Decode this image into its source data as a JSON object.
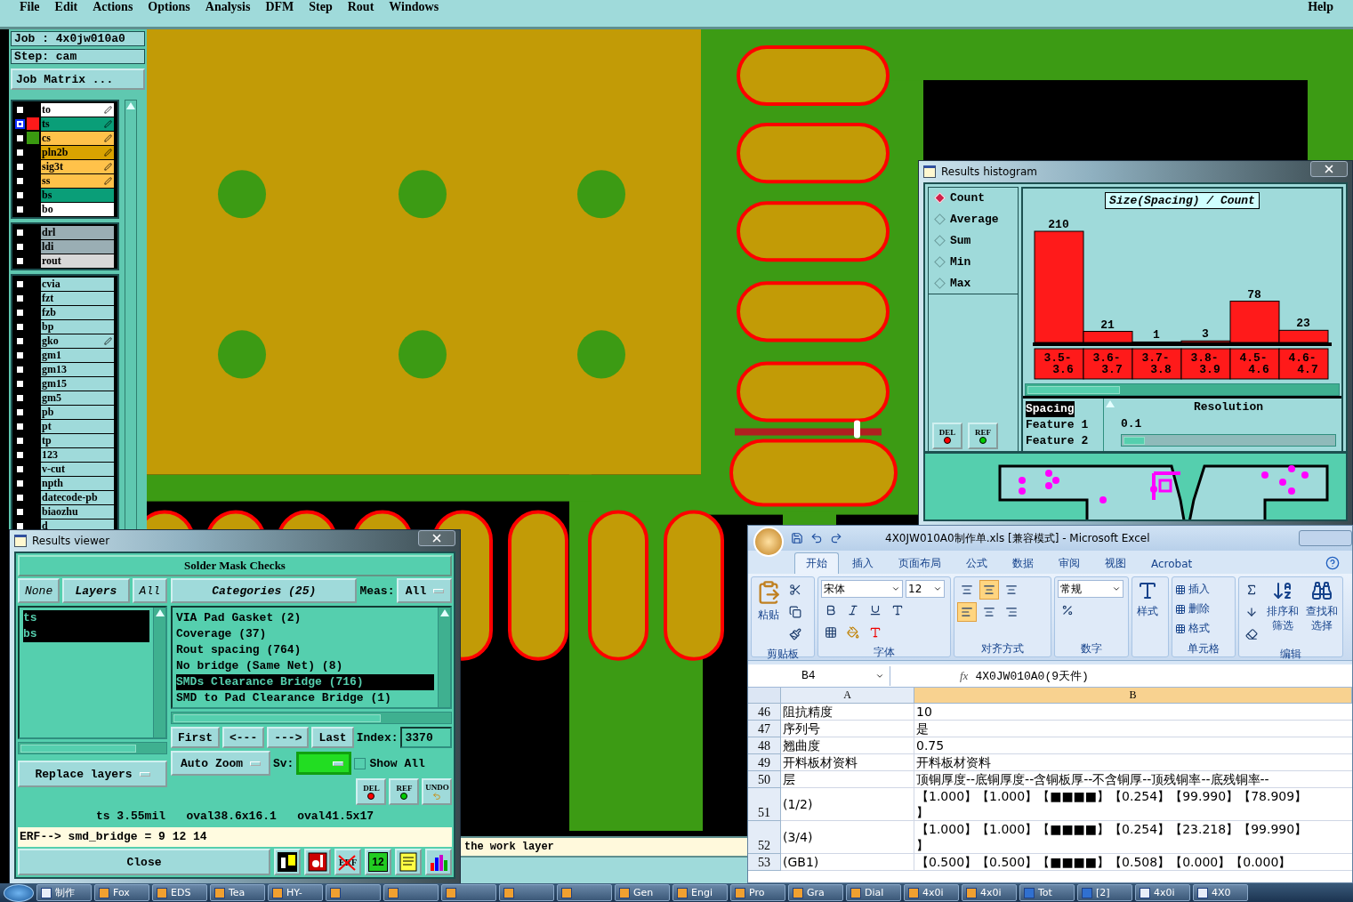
{
  "menu_bar": {
    "items": [
      "File",
      "Edit",
      "Actions",
      "Options",
      "Analysis",
      "DFM",
      "Step",
      "Rout",
      "Windows"
    ],
    "help": "Help"
  },
  "job_panel": {
    "job": "Job : 4x0jw010a0",
    "step": "Step: cam",
    "matrix_button": "Job Matrix ..."
  },
  "layer_groups": [
    {
      "items": [
        {
          "name": "to",
          "color": "#ffffff",
          "editable": true,
          "selected": false
        },
        {
          "name": "ts",
          "color": "#0a9e78",
          "swatch": {
            "color": "#ff1a1a"
          },
          "editable": true,
          "selected": true
        },
        {
          "name": "cs",
          "color": "#ffc24a",
          "swatch": {
            "color": "#3a9a10"
          },
          "editable": true,
          "selected": false
        },
        {
          "name": "pln2b",
          "color": "#d9a300",
          "editable": true,
          "selected": false
        },
        {
          "name": "sig3t",
          "color": "#ffc24a",
          "editable": true,
          "selected": false
        },
        {
          "name": "ss",
          "color": "#ffc24a",
          "editable": true,
          "selected": false
        },
        {
          "name": "bs",
          "color": "#0a9e78",
          "editable": false,
          "selected": false
        },
        {
          "name": "bo",
          "color": "#ffffff",
          "editable": false,
          "selected": false
        }
      ]
    },
    {
      "items": [
        {
          "name": "drl",
          "color": "#9aaeb4",
          "editable": false,
          "selected": false
        },
        {
          "name": "ldi",
          "color": "#9aaeb4",
          "editable": false,
          "selected": false
        },
        {
          "name": "rout",
          "color": "#d8d8d8",
          "editable": false,
          "selected": false
        }
      ]
    },
    {
      "items": [
        {
          "name": "cvia",
          "color": "#9fdada",
          "editable": false,
          "selected": false
        },
        {
          "name": "fzt",
          "color": "#9fdada",
          "editable": false,
          "selected": false
        },
        {
          "name": "fzb",
          "color": "#9fdada",
          "editable": false,
          "selected": false
        },
        {
          "name": "bp",
          "color": "#9fdada",
          "editable": false,
          "selected": false
        },
        {
          "name": "gko",
          "color": "#9fdada",
          "editable": true,
          "selected": false
        },
        {
          "name": "gm1",
          "color": "#9fdada",
          "editable": false,
          "selected": false
        },
        {
          "name": "gm13",
          "color": "#9fdada",
          "editable": false,
          "selected": false
        },
        {
          "name": "gm15",
          "color": "#9fdada",
          "editable": false,
          "selected": false
        },
        {
          "name": "gm5",
          "color": "#9fdada",
          "editable": false,
          "selected": false
        },
        {
          "name": "pb",
          "color": "#9fdada",
          "editable": false,
          "selected": false
        },
        {
          "name": "pt",
          "color": "#9fdada",
          "editable": false,
          "selected": false
        },
        {
          "name": "tp",
          "color": "#9fdada",
          "editable": false,
          "selected": false
        },
        {
          "name": "123",
          "color": "#9fdada",
          "editable": false,
          "selected": false
        },
        {
          "name": "v-cut",
          "color": "#9fdada",
          "editable": false,
          "selected": false
        },
        {
          "name": "npth",
          "color": "#9fdada",
          "editable": false,
          "selected": false
        },
        {
          "name": "datecode-pb",
          "color": "#9fdada",
          "editable": false,
          "selected": false
        },
        {
          "name": "biaozhu",
          "color": "#9fdada",
          "editable": false,
          "selected": false
        },
        {
          "name": "d",
          "color": "#9fdada",
          "editable": false,
          "selected": false
        }
      ]
    }
  ],
  "status": {
    "message": "the work layer"
  },
  "results_viewer": {
    "title": "Results viewer",
    "header": "Solder Mask Checks",
    "layer_buttons": [
      "None",
      "Layers",
      "All"
    ],
    "layers": [
      {
        "name": "ts",
        "selected": true
      },
      {
        "name": "bs",
        "selected": true
      }
    ],
    "replace_button": "Replace layers",
    "categories_button": "Categories (25)",
    "meas_label": "Meas:",
    "meas_value": "All",
    "categories": [
      {
        "label": "VIA Pad Gasket (2)",
        "selected": false
      },
      {
        "label": "Coverage (37)",
        "selected": false
      },
      {
        "label": "Rout spacing (764)",
        "selected": false
      },
      {
        "label": "No bridge (Same Net) (8)",
        "selected": false
      },
      {
        "label": "SMDs Clearance Bridge (716)",
        "selected": true
      },
      {
        "label": "SMD to Pad Clearance Bridge (1)",
        "selected": false
      }
    ],
    "nav_buttons": [
      "First",
      "<---",
      "--->",
      "Last"
    ],
    "index_label": "Index:",
    "index_value": "3370",
    "zoom_button": "Auto Zoom",
    "sv_label": "Sv:",
    "show_all": {
      "label": "Show All",
      "checked": false
    },
    "action_buttons": [
      {
        "label": "DEL",
        "kind": "del"
      },
      {
        "label": "REF",
        "kind": "ref"
      },
      {
        "label": "UNDO",
        "kind": "undo"
      }
    ],
    "measurement": "ts 3.55mil   oval38.6x16.1   oval41.5x17",
    "erf": "ERF--> smd_bridge = 9 12 14",
    "close_button": "Close",
    "tools": [
      {
        "kind": "figure"
      },
      {
        "kind": "marker"
      },
      {
        "kind": "erf",
        "label": "ERF"
      },
      {
        "kind": "numbers",
        "label": "12"
      },
      {
        "kind": "note"
      },
      {
        "kind": "chart"
      }
    ]
  },
  "histogram": {
    "title": "Results histogram",
    "options": [
      {
        "label": "Count",
        "selected": true
      },
      {
        "label": "Average",
        "selected": false
      },
      {
        "label": "Sum",
        "selected": false
      },
      {
        "label": "Min",
        "selected": false
      },
      {
        "label": "Max",
        "selected": false
      }
    ],
    "action_buttons": [
      {
        "label": "DEL",
        "kind": "del"
      },
      {
        "label": "REF",
        "kind": "ref"
      }
    ],
    "chart_data": {
      "type": "bar",
      "title": "Size(Spacing) / Count",
      "categories": [
        "3.5-3.6",
        "3.6-3.7",
        "3.7-3.8",
        "3.8-3.9",
        "4.5-4.6",
        "4.6-4.7"
      ],
      "values": [
        210,
        21,
        1,
        3,
        78,
        23
      ],
      "data_labels": true
    },
    "fields": [
      {
        "label": "Spacing",
        "selected": true
      },
      {
        "label": "Feature 1",
        "selected": false
      },
      {
        "label": "Feature 2",
        "selected": false
      }
    ],
    "resolution_label": "Resolution",
    "resolution_value": "0.1"
  },
  "excel": {
    "title": "4X0JW010A0制作单.xls  [兼容模式] - Microsoft Excel",
    "tabs": [
      {
        "label": "开始",
        "selected": true
      },
      {
        "label": "插入",
        "selected": false
      },
      {
        "label": "页面布局",
        "selected": false
      },
      {
        "label": "公式",
        "selected": false
      },
      {
        "label": "数据",
        "selected": false
      },
      {
        "label": "审阅",
        "selected": false
      },
      {
        "label": "视图",
        "selected": false
      },
      {
        "label": "Acrobat",
        "selected": false
      }
    ],
    "ribbon": {
      "paste": "粘贴",
      "font": "宋体",
      "size": "12",
      "number_format": "常规",
      "styles": "样式",
      "cell_buttons": [
        "插入",
        "删除",
        "格式"
      ],
      "sort": "排序和筛选",
      "find": "查找和选择",
      "group_labels": [
        "剪贴板",
        "字体",
        "对齐方式",
        "数字",
        "单元格",
        "编辑"
      ]
    },
    "name_box": "B4",
    "fx_label": "fx",
    "formula": "4X0JW010A0(9天件)",
    "columns": [
      {
        "label": "A",
        "selected": false
      },
      {
        "label": "B",
        "selected": true
      }
    ],
    "rows": [
      {
        "number": "46",
        "a": "阻抗精度",
        "b": [
          "10"
        ]
      },
      {
        "number": "47",
        "a": "序列号",
        "b": [
          "是"
        ]
      },
      {
        "number": "48",
        "a": "翘曲度",
        "b": [
          "0.75"
        ]
      },
      {
        "number": "49",
        "a": "开料板材资料",
        "b": [
          "开料板材资料"
        ]
      },
      {
        "number": "50",
        "a": "层",
        "b": [
          "顶铜厚度--底铜厚度--含铜板厚--不含铜厚--顶残铜率--底残铜率--"
        ]
      },
      {
        "number": "51",
        "a": "(1/2)",
        "b": [
          "【1.000】【1.000】【■■■■】【0.254】【99.990】【78.909】",
          "】"
        ]
      },
      {
        "number": "52",
        "a": "(3/4)",
        "b": [
          "【1.000】【1.000】【■■■■】【0.254】【23.218】【99.990】",
          "】"
        ]
      },
      {
        "number": "53",
        "a": "(GB1)",
        "b": [
          "【0.500】【0.500】【■■■■】【0.508】【0.000】【0.000】"
        ]
      }
    ]
  },
  "taskbar": {
    "items": [
      {
        "kind": "doc",
        "label": "制作"
      },
      {
        "kind": "app",
        "label": "Fox"
      },
      {
        "kind": "app",
        "label": "EDS"
      },
      {
        "kind": "app",
        "label": "Tea"
      },
      {
        "kind": "app",
        "label": "HY-"
      },
      {
        "kind": "app"
      },
      {
        "kind": "app"
      },
      {
        "kind": "app"
      },
      {
        "kind": "app"
      },
      {
        "kind": "app"
      },
      {
        "kind": "app",
        "label": "Gen"
      },
      {
        "kind": "app",
        "label": "Engi"
      },
      {
        "kind": "app",
        "label": "Pro"
      },
      {
        "kind": "app",
        "label": "Gra"
      },
      {
        "kind": "app",
        "label": "Dial"
      },
      {
        "kind": "app",
        "label": "4x0i"
      },
      {
        "kind": "app",
        "label": "4x0i"
      },
      {
        "kind": "disk",
        "label": "Tot"
      },
      {
        "kind": "disk",
        "label": "[2]"
      },
      {
        "kind": "doc",
        "label": "4x0i"
      },
      {
        "kind": "doc",
        "label": "4X0"
      }
    ]
  }
}
